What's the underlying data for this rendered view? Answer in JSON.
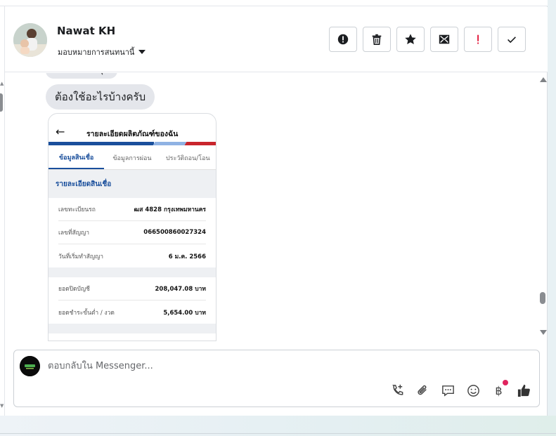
{
  "header": {
    "name": "Nawat KH",
    "assign_label": "มอบหมายการสนทนานี้",
    "actions": [
      {
        "id": "spam",
        "icon": "alert-circle-icon"
      },
      {
        "id": "delete",
        "icon": "trash-icon"
      },
      {
        "id": "star",
        "icon": "star-icon"
      },
      {
        "id": "mark-unread",
        "icon": "envelope-icon"
      },
      {
        "id": "follow-up",
        "icon": "exclamation-icon"
      },
      {
        "id": "done",
        "icon": "check-icon"
      }
    ]
  },
  "colors": {
    "accent": "#1a4f9c",
    "stripe_red": "#c9252c",
    "bubble_bg": "#e4e6eb",
    "notification": "#e0245e"
  },
  "messages": {
    "partial_text": "ุ",
    "bubble_text": "ต้องใช้อะไรบ้างครับ"
  },
  "attachment": {
    "title": "รายละเอียดผลิตภัณฑ์ของฉัน",
    "tabs": [
      {
        "label": "ข้อมูลสินเชื่อ",
        "active": true
      },
      {
        "label": "ข้อมูลการผ่อน",
        "active": false
      },
      {
        "label": "ประวัติถอน/โอน",
        "active": false
      }
    ],
    "section_title": "รายละเอียดสินเชื่อ",
    "rows_group1": [
      {
        "label": "เลขทะเบียนรถ",
        "value": "ฒส 4828 กรุงเทพมหานคร"
      },
      {
        "label": "เลขที่สัญญา",
        "value": "066500860027324"
      },
      {
        "label": "วันที่เริ่มทำสัญญา",
        "value": "6 ม.ค. 2566"
      }
    ],
    "rows_group2": [
      {
        "label": "ยอดปิดบัญชี",
        "value": "208,047.08 บาท"
      },
      {
        "label": "ยอดชำระขั้นต่ำ / งวด",
        "value": "5,654.00 บาท"
      }
    ]
  },
  "composer": {
    "placeholder": "ตอบกลับใน Messenger...",
    "tools": [
      "phone-plus-icon",
      "paperclip-icon",
      "chat-bubble-icon",
      "emoji-icon",
      "baht-icon",
      "thumbs-up-icon"
    ],
    "baht_symbol": "฿"
  }
}
